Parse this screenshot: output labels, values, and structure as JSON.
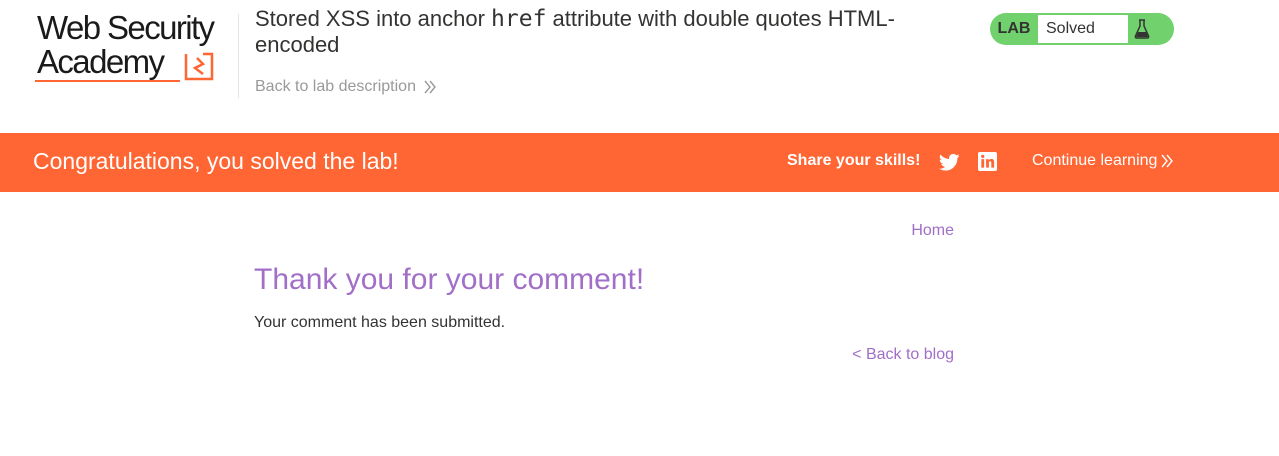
{
  "header": {
    "logo_line1": "Web Security",
    "logo_line2": "Academy",
    "title_part1": "Stored XSS into anchor ",
    "title_code": "href",
    "title_part2": " attribute with double quotes HTML-encoded",
    "back_link": "Back to lab description",
    "status": {
      "badge": "LAB",
      "text": "Solved",
      "icon": "flask-icon"
    }
  },
  "banner": {
    "message": "Congratulations, you solved the lab!",
    "share_label": "Share your skills!",
    "continue_label": "Continue learning",
    "icons": [
      "twitter-icon",
      "linkedin-icon"
    ]
  },
  "main": {
    "nav_home": "Home",
    "heading": "Thank you for your comment!",
    "message": "Your comment has been submitted.",
    "back_to_blog": "< Back to blog"
  },
  "colors": {
    "accent": "#ff6633",
    "link": "#a16ec8",
    "solved": "#70d16d",
    "text": "#333332"
  }
}
